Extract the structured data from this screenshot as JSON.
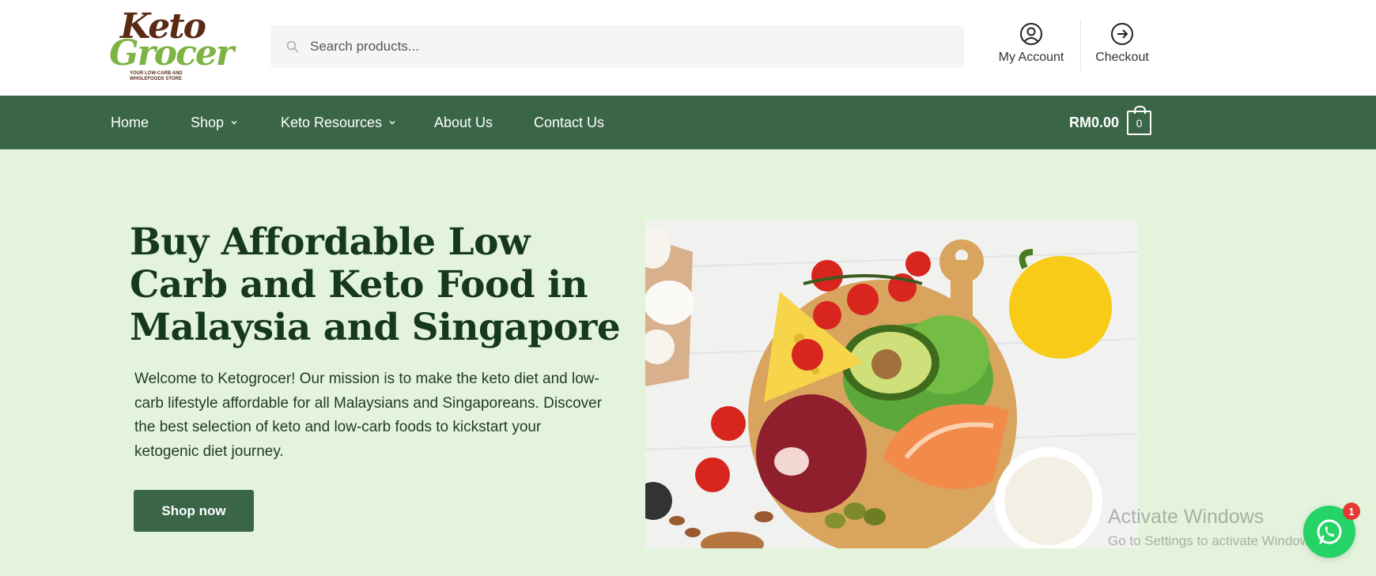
{
  "logo": {
    "line1": "Keto",
    "line2": "Grocer",
    "tagline": "YOUR LOW-CARB AND WHOLEFOODS STORE"
  },
  "search": {
    "placeholder": "Search products..."
  },
  "header_links": {
    "account": "My Account",
    "checkout": "Checkout"
  },
  "nav": {
    "items": [
      {
        "label": "Home"
      },
      {
        "label": "Shop"
      },
      {
        "label": "Keto Resources"
      },
      {
        "label": "About Us"
      },
      {
        "label": "Contact Us"
      }
    ],
    "cart_total": "RM0.00",
    "cart_count": "0"
  },
  "hero": {
    "title": "Buy Affordable Low Carb and Keto Food in Malaysia and Singapore",
    "text": "Welcome to Ketogrocer! Our mission is to make the keto diet and low-carb lifestyle affordable for all Malaysians and Singaporeans. Discover the best selection of keto and low-carb foods to kickstart your ketogenic diet journey.",
    "button": "Shop now"
  },
  "watermark": {
    "line1": "Activate Windows",
    "line2": "Go to Settings to activate Windows."
  },
  "whatsapp": {
    "badge": "1"
  },
  "colors": {
    "brand_green": "#3a6647",
    "hero_bg": "#e4f4dc",
    "title": "#15381f",
    "whatsapp": "#25d366",
    "badge": "#e53935"
  }
}
